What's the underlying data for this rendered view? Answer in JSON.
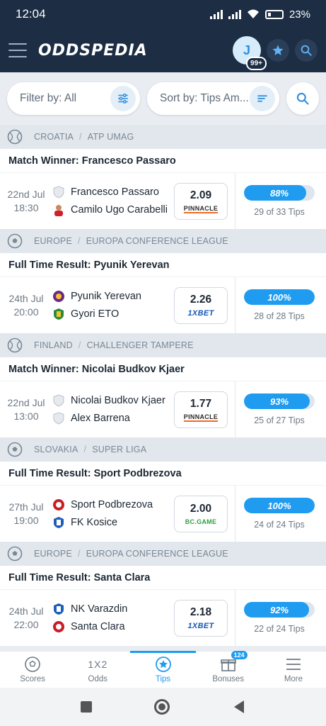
{
  "status": {
    "time": "12:04",
    "battery": "23%"
  },
  "appbar": {
    "logo": "ODDSPEDIA",
    "avatar_letter": "J",
    "avatar_badge": "99+"
  },
  "filters": {
    "filter_label": "Filter by: All",
    "sort_label": "Sort by: Tips Am..."
  },
  "tips": [
    {
      "sport": "tennis",
      "country": "CROATIA",
      "league": "ATP UMAG",
      "market": "Match Winner: Francesco Passaro",
      "date": "22nd Jul",
      "time": "18:30",
      "home": "Francesco Passaro",
      "away": "Camilo Ugo Carabelli",
      "odds": "2.09",
      "bookmaker": "PINNACLE",
      "bk_class": "bk-pinnacle",
      "percent": "88%",
      "percent_value": 88,
      "tips_count": "29 of 33 Tips",
      "home_crest": "shield",
      "away_crest": "player"
    },
    {
      "sport": "football",
      "country": "EUROPE",
      "league": "EUROPA CONFERENCE LEAGUE",
      "market": "Full Time Result: Pyunik Yerevan",
      "date": "24th Jul",
      "time": "20:00",
      "home": "Pyunik Yerevan",
      "away": "Gyori ETO",
      "odds": "2.26",
      "bookmaker": "1XBET",
      "bk_class": "bk-1xbet",
      "percent": "100%",
      "percent_value": 100,
      "tips_count": "28 of 28 Tips",
      "home_crest": "purple",
      "away_crest": "green"
    },
    {
      "sport": "tennis",
      "country": "FINLAND",
      "league": "CHALLENGER TAMPERE",
      "market": "Match Winner: Nicolai Budkov Kjaer",
      "date": "22nd Jul",
      "time": "13:00",
      "home": "Nicolai Budkov Kjaer",
      "away": "Alex Barrena",
      "odds": "1.77",
      "bookmaker": "PINNACLE",
      "bk_class": "bk-pinnacle",
      "percent": "93%",
      "percent_value": 93,
      "tips_count": "25 of 27 Tips",
      "home_crest": "shield",
      "away_crest": "shield"
    },
    {
      "sport": "football",
      "country": "SLOVAKIA",
      "league": "SUPER LIGA",
      "market": "Full Time Result: Sport Podbrezova",
      "date": "27th Jul",
      "time": "19:00",
      "home": "Sport Podbrezova",
      "away": "FK Kosice",
      "odds": "2.00",
      "bookmaker": "BC.GAME",
      "bk_class": "bk-bcgame",
      "percent": "100%",
      "percent_value": 100,
      "tips_count": "24 of 24 Tips",
      "home_crest": "red",
      "away_crest": "blue"
    },
    {
      "sport": "football",
      "country": "EUROPE",
      "league": "EUROPA CONFERENCE LEAGUE",
      "market": "Full Time Result: Santa Clara",
      "date": "24th Jul",
      "time": "22:00",
      "home": "NK Varazdin",
      "away": "Santa Clara",
      "odds": "2.18",
      "bookmaker": "1XBET",
      "bk_class": "bk-1xbet",
      "percent": "92%",
      "percent_value": 92,
      "tips_count": "22 of 24 Tips",
      "home_crest": "blue",
      "away_crest": "red"
    }
  ],
  "nav": [
    {
      "label": "Scores",
      "icon": "ball-icon",
      "active": false
    },
    {
      "label": "Odds",
      "icon": "odds-icon",
      "active": false,
      "glyph": "1X2"
    },
    {
      "label": "Tips",
      "icon": "tips-icon",
      "active": true
    },
    {
      "label": "Bonuses",
      "icon": "gift-icon",
      "active": false,
      "badge": "124"
    },
    {
      "label": "More",
      "icon": "menu-icon",
      "active": false
    }
  ],
  "colors": {
    "header": "#1c2d44",
    "accent": "#1f9cf0"
  }
}
